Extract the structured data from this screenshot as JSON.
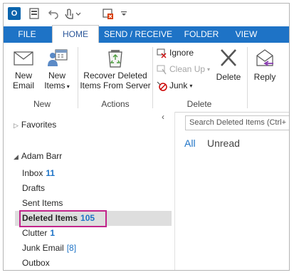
{
  "quick_access": {
    "app_icon_letter": "O"
  },
  "tabs": [
    {
      "label": "FILE",
      "active": false
    },
    {
      "label": "HOME",
      "active": true
    },
    {
      "label": "SEND / RECEIVE",
      "active": false
    },
    {
      "label": "FOLDER",
      "active": false
    },
    {
      "label": "VIEW",
      "active": false
    }
  ],
  "ribbon": {
    "new_email": {
      "line1": "New",
      "line2": "Email"
    },
    "new_items": {
      "line1": "New",
      "line2": "Items"
    },
    "group_new": "New",
    "recover": {
      "line1": "Recover Deleted",
      "line2": "Items From Server"
    },
    "group_actions": "Actions",
    "ignore": "Ignore",
    "clean_up": "Clean Up",
    "junk": "Junk",
    "delete": "Delete",
    "group_delete": "Delete",
    "reply": "Reply"
  },
  "folder_pane": {
    "favorites": "Favorites",
    "account": "Adam Barr",
    "folders": [
      {
        "name": "Inbox",
        "count": "11"
      },
      {
        "name": "Drafts",
        "count": ""
      },
      {
        "name": "Sent Items",
        "count": ""
      },
      {
        "name": "Deleted Items",
        "count": "105"
      },
      {
        "name": "Clutter",
        "count": "1"
      },
      {
        "name": "Junk Email",
        "count": "[8]"
      },
      {
        "name": "Outbox",
        "count": ""
      }
    ]
  },
  "message_list": {
    "search_placeholder": "Search Deleted Items (Ctrl+",
    "filter_all": "All",
    "filter_unread": "Unread"
  },
  "colors": {
    "accent": "#1e73c6",
    "highlight_border": "#c2248b"
  }
}
